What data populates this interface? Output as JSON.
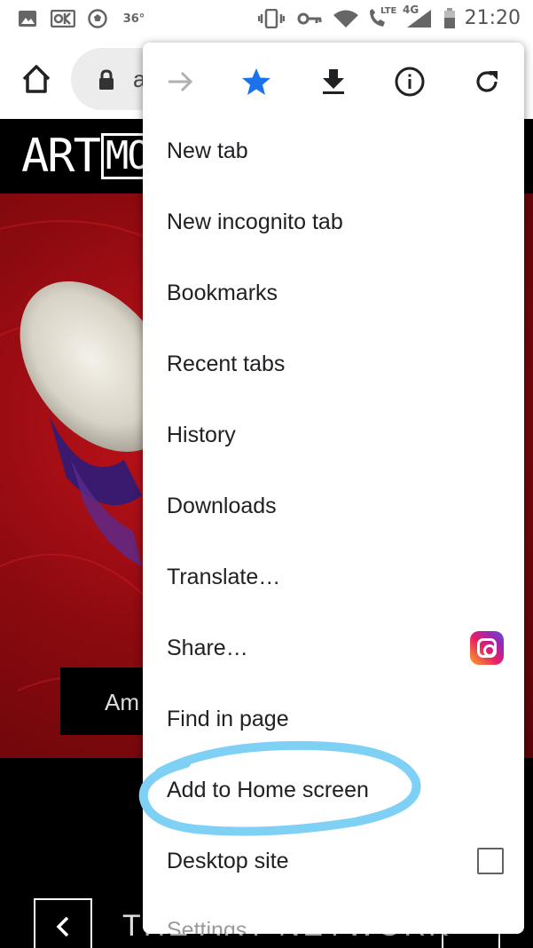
{
  "status_bar": {
    "temperature": "36°",
    "network": "4G",
    "lte": "LTE",
    "time": "21:20",
    "icons": [
      "image-icon",
      "ok-icon",
      "soccer-ball-icon",
      "vibrate-icon",
      "key-icon",
      "wifi-icon",
      "lte-call-icon",
      "signal-icon",
      "battery-icon"
    ]
  },
  "toolbar": {
    "url_partial": "a",
    "icons": [
      "home-icon",
      "lock-icon"
    ]
  },
  "page": {
    "logo_text": "ART",
    "logo_boxed": "MO",
    "caption": "Am",
    "footer_title": "THE ART NETWORK"
  },
  "menu": {
    "top_icons": [
      "forward-icon",
      "bookmark-star-icon",
      "download-icon",
      "info-icon",
      "reload-icon"
    ],
    "star_color": "#1a73e8",
    "items": [
      {
        "label": "New tab"
      },
      {
        "label": "New incognito tab"
      },
      {
        "label": "Bookmarks"
      },
      {
        "label": "Recent tabs"
      },
      {
        "label": "History"
      },
      {
        "label": "Downloads"
      },
      {
        "label": "Translate…"
      },
      {
        "label": "Share…",
        "icon": "instagram-icon"
      },
      {
        "label": "Find in page"
      },
      {
        "label": "Add to Home screen"
      },
      {
        "label": "Desktop site",
        "checked": false
      },
      {
        "label": "Settings"
      }
    ]
  },
  "annotation": {
    "highlight_color": "#7fd0f5",
    "highlighted_item": "Add to Home screen"
  }
}
